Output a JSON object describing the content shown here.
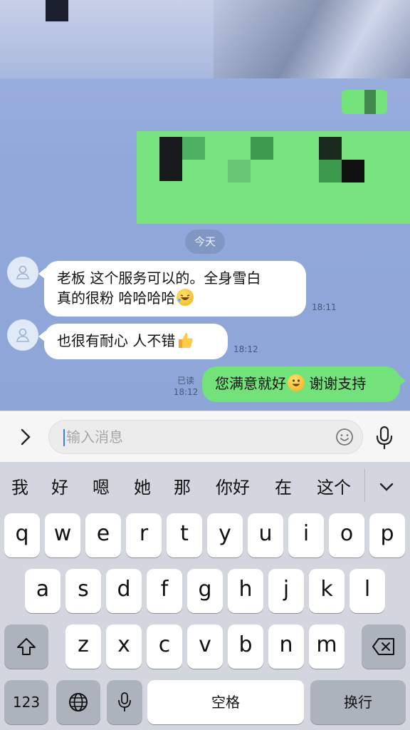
{
  "chat": {
    "date_label": "今天",
    "messages": [
      {
        "side": "left",
        "lines": [
          "老板 这个服务可以的。全身雪白",
          "真的很粉 哈哈哈哈"
        ],
        "emoji": "rolling-on-floor-laughing",
        "time": "18:11"
      },
      {
        "side": "left",
        "lines": [
          "也很有耐心 人不错"
        ],
        "emoji": "thumbs-up",
        "time": "18:12"
      },
      {
        "side": "right",
        "lines": [
          "您满意就好",
          " 谢谢支持"
        ],
        "emoji": "smiling-face",
        "time": "18:12",
        "status": "已读"
      }
    ]
  },
  "input": {
    "placeholder": "输入消息"
  },
  "candidates": [
    "我",
    "好",
    "嗯",
    "她",
    "那",
    "你好",
    "在",
    "这个"
  ],
  "keyboard": {
    "row1": [
      "q",
      "w",
      "e",
      "r",
      "t",
      "y",
      "u",
      "i",
      "o",
      "p"
    ],
    "row2": [
      "a",
      "s",
      "d",
      "f",
      "g",
      "h",
      "j",
      "k",
      "l"
    ],
    "row3": [
      "z",
      "x",
      "c",
      "v",
      "b",
      "n",
      "m"
    ],
    "numbers_label": "123",
    "space_label": "空格",
    "return_label": "换行"
  },
  "colors": {
    "chat_bg": "#92a8da",
    "outgoing_bubble": "#73e27a",
    "incoming_bubble": "#ffffff",
    "keyboard_bg": "#d3d6de"
  }
}
